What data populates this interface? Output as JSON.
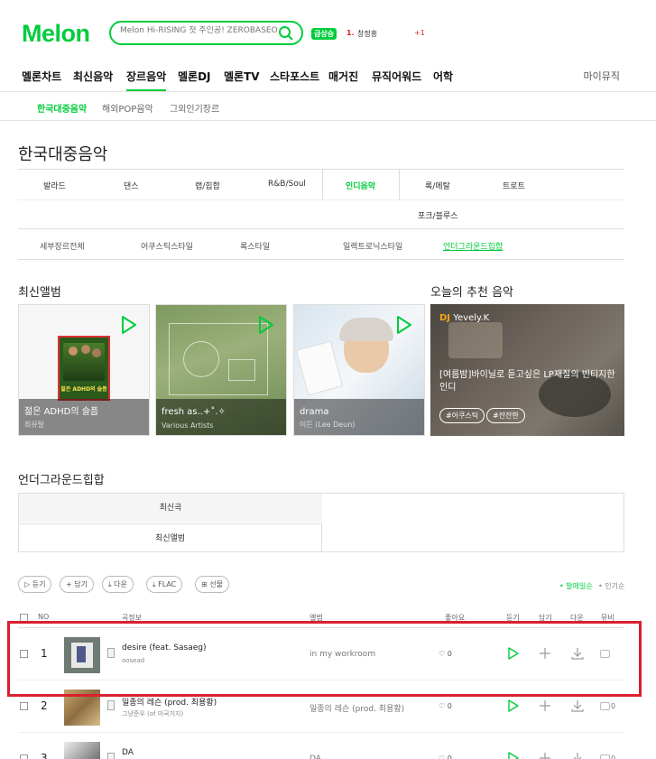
{
  "header": {
    "logo": "Melon",
    "search_placeholder": "Melon Hi-RISING 첫 주인공! ZEROBASEONE",
    "realtime_badge": "급상승",
    "rank_num": "1.",
    "rank_title": "창정흥",
    "rank_change": "+1"
  },
  "gnb": {
    "items": [
      "멜론차트",
      "최신음악",
      "장르음악",
      "멜론DJ",
      "멜론TV",
      "스타포스트",
      "매거진",
      "뮤직어워드",
      "어학"
    ],
    "active_index": 2,
    "my_music": "마이뮤직"
  },
  "sub_tabs": {
    "items": [
      "한국대중음악",
      "해외POP음악",
      "그외인기장르"
    ],
    "active_index": 0
  },
  "page_title": "한국대중음악",
  "genres": {
    "row1": [
      "발라드",
      "댄스",
      "랩/힙합",
      "R&B/Soul",
      "인디음악",
      "록/메탈",
      "트로트"
    ],
    "row2": [
      "포크/블루스"
    ],
    "active": "인디음악"
  },
  "styles": {
    "items": [
      "세부장르전체",
      "어쿠스틱스타일",
      "록스타일",
      "일렉트로닉스타일",
      "언더그라운드힙합"
    ],
    "active_index": 4
  },
  "new_albums": {
    "title": "최신앨범",
    "items": [
      {
        "title": "젊은 ADHD의 슬픔",
        "artist": "최유탈",
        "cover_text": "젊은 ADHD의 슬픔"
      },
      {
        "title": "fresh as..+˚.✧",
        "artist": "Various Artists"
      },
      {
        "title": "drama",
        "artist": "이든 (Lee Deun)"
      }
    ]
  },
  "recommend": {
    "title": "오늘의 추천 음악",
    "dj_label": "DJ",
    "dj_name": "Yevely.K",
    "description": "[여름밤]바이닐로 듣고싶은 LP재질의 빈티지한 인디",
    "tags": [
      "#어쿠스틱",
      "#잔잔한"
    ]
  },
  "underground": {
    "title": "언더그라운드힙합",
    "tabs": [
      "최신곡",
      "최신앨범"
    ],
    "selected_index": 0
  },
  "toolbar": {
    "buttons": [
      "듣기",
      "담기",
      "다운",
      "FLAC",
      "선물"
    ],
    "sort_active": "발매일순",
    "sort_other": "인기순"
  },
  "table": {
    "headers": {
      "no": "NO",
      "song": "곡정보",
      "album": "앨범",
      "like": "좋아요",
      "listen": "듣기",
      "add": "담기",
      "down": "다운",
      "mv": "뮤비"
    },
    "rows": [
      {
        "rank": "1",
        "title": "desire (feat. Sasaeg)",
        "artist": "oosead",
        "album": "in my workroom",
        "likes": "0",
        "mv": ""
      },
      {
        "rank": "2",
        "title": "일종의 레슨 (prod. 최용황)",
        "artist": "그냥준우 (of 미국거지)",
        "album": "일종의 레슨 (prod. 최용황)",
        "likes": "0",
        "mv": "0"
      },
      {
        "rank": "3",
        "title": "DA",
        "artist": "",
        "album": "DA",
        "likes": "0",
        "mv": "0"
      }
    ]
  },
  "colors": {
    "brand": "#00cd3c",
    "highlight": "#d92030",
    "rank": "#e0251b"
  }
}
